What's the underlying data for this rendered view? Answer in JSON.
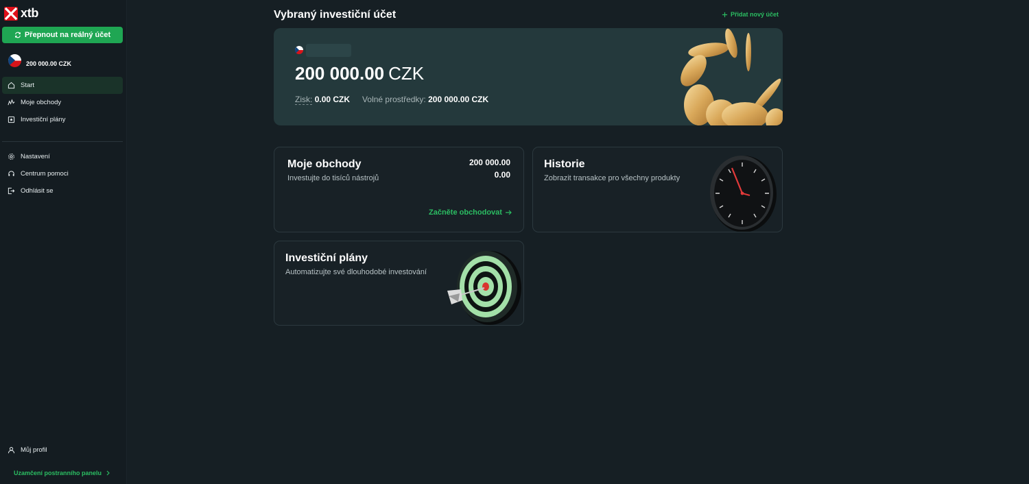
{
  "app": {
    "logo_text": "xtb"
  },
  "sidebar": {
    "switch_button_label": "Přepnout na reálný účet",
    "account_balance": "200 000.00 CZK",
    "nav_main": [
      {
        "label": "Start",
        "icon": "home-icon",
        "active": true
      },
      {
        "label": "Moje obchody",
        "icon": "trades-icon",
        "active": false
      },
      {
        "label": "Investiční plány",
        "icon": "plans-icon",
        "active": false
      }
    ],
    "nav_secondary": [
      {
        "label": "Nastavení",
        "icon": "gear-icon"
      },
      {
        "label": "Centrum pomoci",
        "icon": "headset-icon"
      },
      {
        "label": "Odhlásit se",
        "icon": "logout-icon"
      }
    ],
    "profile_label": "Můj profil",
    "lock_sidebar_label": "Uzamčení postranního panelu"
  },
  "main": {
    "title": "Vybraný investiční účet",
    "add_account_label": "Přidat nový účet",
    "account_card": {
      "balance_amount": "200 000.00",
      "balance_currency": "CZK",
      "profit_label": "Zisk:",
      "profit_value": "0.00 CZK",
      "free_funds_label": "Volné prostředky:",
      "free_funds_value": "200 000.00 CZK"
    },
    "tiles": {
      "trades": {
        "title": "Moje obchody",
        "subtitle": "Investujte do tisíců nástrojů",
        "value_1": "200 000.00",
        "value_2": "0.00",
        "link_label": "Začněte obchodovat"
      },
      "history": {
        "title": "Historie",
        "subtitle": "Zobrazit transakce pro všechny produkty"
      },
      "plans": {
        "title": "Investiční plány",
        "subtitle": "Automatizujte své dlouhodobé investování"
      }
    }
  },
  "colors": {
    "background": "#161f24",
    "sidebar": "#141c21",
    "accent_green": "#1fa653",
    "link_green": "#2bbd62",
    "card": "#24393c",
    "brand_red": "#e0101a"
  }
}
